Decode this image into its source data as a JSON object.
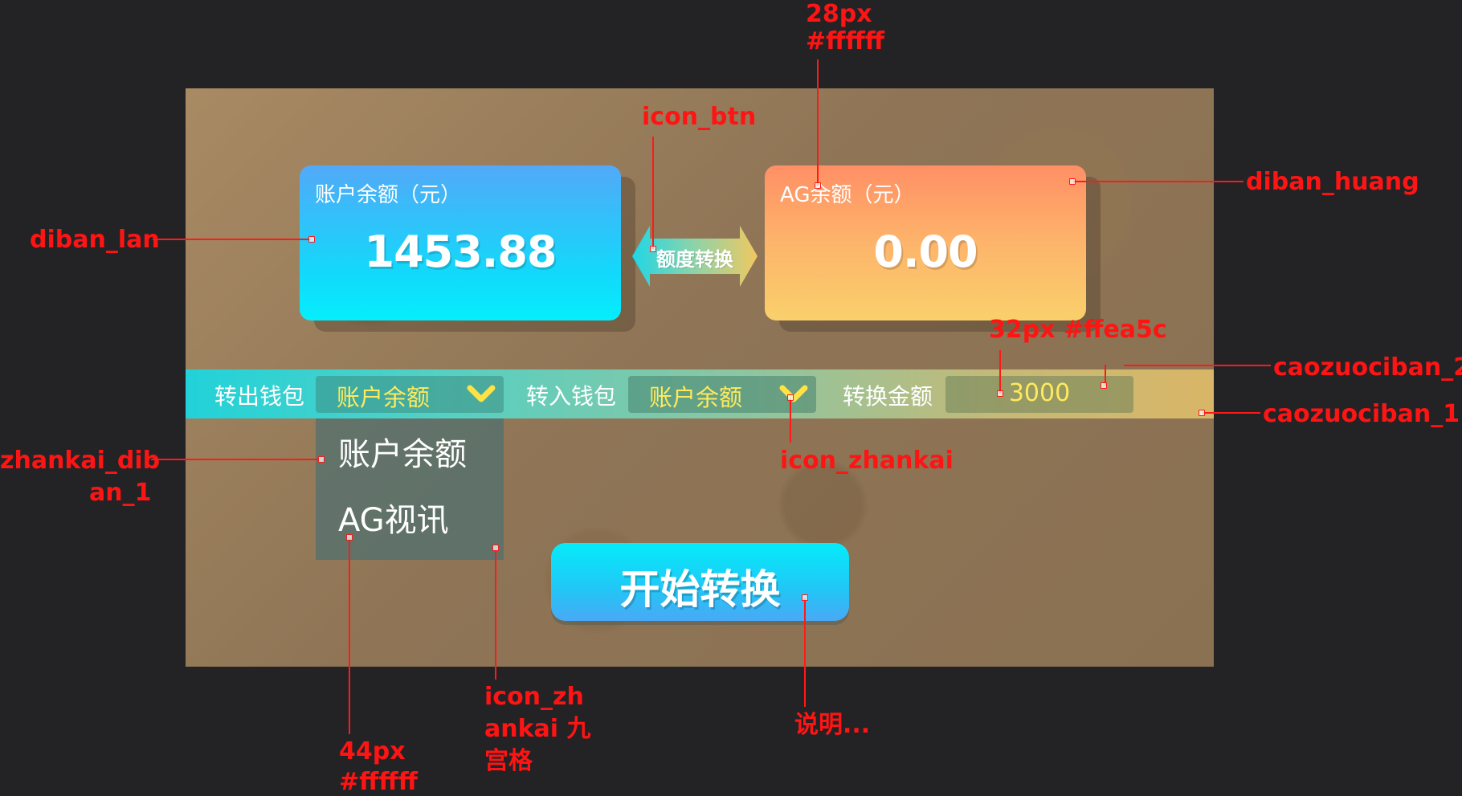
{
  "cards": {
    "account": {
      "label": "账户余额（元）",
      "value": "1453.88"
    },
    "ag": {
      "label": "AG余额（元）",
      "value": "0.00"
    }
  },
  "swap_button": {
    "label": "额度转换"
  },
  "operation_bar": {
    "out_label": "转出钱包",
    "out_value": "账户余额",
    "in_label": "转入钱包",
    "in_value": "账户余额",
    "amount_label": "转换金额",
    "amount_value": "3000"
  },
  "dropdown": {
    "items": [
      "账户余额",
      "AG视讯"
    ]
  },
  "start_button": {
    "label": "开始转换"
  },
  "annotations": {
    "top_size": "28px",
    "top_color": "#ffffff",
    "icon_btn": "icon_btn",
    "diban_lan": "diban_lan",
    "diban_huang": "diban_huang",
    "amount_spec": "32px #ffea5c",
    "caozuociban_2": "caozuociban_2",
    "caozuociban_1": "caozuociban_1",
    "zhankai_diban_line1": "zhankai_dib",
    "zhankai_diban_line2": "an_1",
    "icon_zhankai": "icon_zhankai",
    "icon_zhankai_grid_line1": "icon_zh",
    "icon_zhankai_grid_line2": "ankai 九",
    "icon_zhankai_grid_line3": "宫格",
    "dropdown_size": "44px",
    "dropdown_color": "#ffffff",
    "note": "说明..."
  },
  "colors": {
    "background": "#232326",
    "annotation": "#ff1414",
    "select_text": "#ffea5c",
    "white": "#ffffff"
  }
}
